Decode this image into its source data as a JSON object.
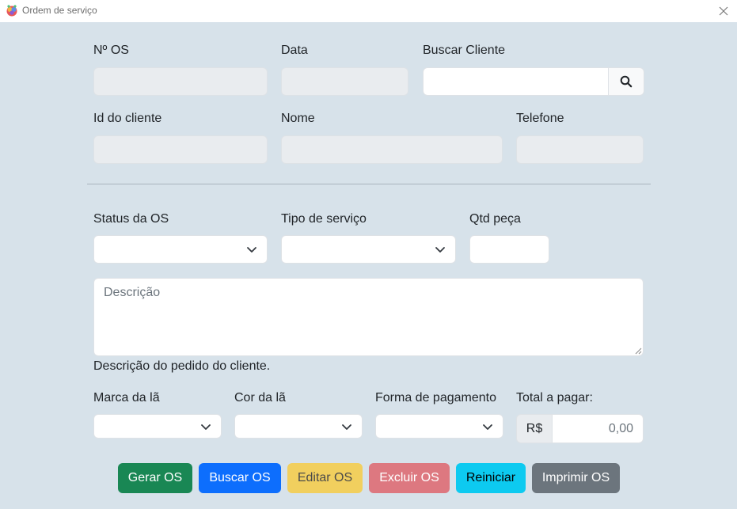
{
  "window": {
    "title": "Ordem de serviço"
  },
  "icons": {
    "app": "app-logo-icon",
    "close": "close-icon",
    "search": "search-icon",
    "chevron": "chevron-down-icon"
  },
  "labels": {
    "os_number": "Nº OS",
    "date": "Data",
    "search_client": "Buscar Cliente",
    "client_id": "Id do cliente",
    "name": "Nome",
    "phone": "Telefone",
    "os_status": "Status da OS",
    "service_type": "Tipo de serviço",
    "piece_qty": "Qtd peça",
    "yarn_brand": "Marca da lã",
    "yarn_color": "Cor da lã",
    "payment_method": "Forma de pagamento",
    "total": "Total a pagar:"
  },
  "fields": {
    "os_number": "",
    "date": "",
    "search_client": "",
    "client_id": "",
    "name": "",
    "phone": "",
    "os_status": "",
    "service_type": "",
    "piece_qty": "",
    "yarn_brand": "",
    "yarn_color": "",
    "payment_method": ""
  },
  "description": {
    "placeholder": "Descrição",
    "help": "Descrição do pedido do cliente."
  },
  "total": {
    "currency": "R$",
    "placeholder": "0,00"
  },
  "buttons": {
    "generate": "Gerar OS",
    "search": "Buscar OS",
    "edit": "Editar OS",
    "delete": "Excluir OS",
    "reset": "Reiniciar",
    "print": "Imprimir OS"
  },
  "colors": {
    "background": "#d7e2ea",
    "generate": "#198754",
    "search": "#0d6efd",
    "edit": "#f1cf5e",
    "delete": "#dd7880",
    "reset": "#0dcaf0",
    "print": "#6c757d"
  }
}
